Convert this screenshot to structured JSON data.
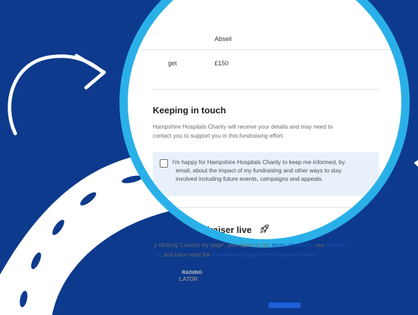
{
  "rows": [
    {
      "label": "",
      "value": "Abseil"
    },
    {
      "label": "get",
      "value": "£150"
    }
  ],
  "keeping": {
    "title": "Keeping in touch",
    "paragraph_line1": "Hampshire Hospitals Charity will receive your details and may need to",
    "paragraph_line2": "contact you to support you in this fundraising effort."
  },
  "consent": {
    "line1": "I'm happy for Hampshire Hospitals Charity to keep me informed, by",
    "line2": "email, about the impact of my fundraising and other ways to stay",
    "line3": "involved including future events, campaigns and appeals."
  },
  "live": {
    "title": "Set your fundraiser live",
    "text_part1": "y clicking 'Launch my page', you agree to our ",
    "terms_link": "terms of service",
    "text_part2": ", our ",
    "privacy_link": "privacy",
    "line2_part1": "cy",
    "line2_part2": ", and have read the ",
    "guidance_link": "Fundraising Regulator's Guidance Notes",
    "line2_part3": "."
  },
  "badge": {
    "line1": "RAISING",
    "line2": "LATOR"
  },
  "colors": {
    "background": "#0d3a8c",
    "lens_ring": "#2ab0e8",
    "link": "#1d4fb3",
    "consent_bg": "#e8f1fb",
    "button": "#1d5fd8"
  },
  "icons": [
    "rocket-icon",
    "checkbox-icon",
    "curved-arrow-icon",
    "road-icon"
  ]
}
